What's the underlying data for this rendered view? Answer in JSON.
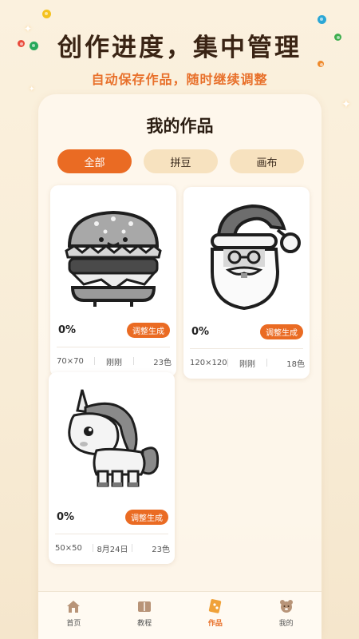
{
  "hero": {
    "title": "创作进度，集中管理",
    "subtitle": "自动保存作品，随时继续调整"
  },
  "panel": {
    "title": "我的作品",
    "tabs": [
      {
        "label": "全部",
        "active": true
      },
      {
        "label": "拼豆",
        "active": false
      },
      {
        "label": "画布",
        "active": false
      }
    ]
  },
  "works": [
    {
      "subject": "hamburger-pattern",
      "progress": "0%",
      "action": "调整生成",
      "size": "70×70",
      "time": "刚刚",
      "colors": "23色"
    },
    {
      "subject": "santa-pattern",
      "progress": "0%",
      "action": "调整生成",
      "size": "120×120",
      "time": "刚刚",
      "colors": "18色"
    },
    {
      "subject": "unicorn-pattern",
      "progress": "0%",
      "action": "调整生成",
      "size": "50×50",
      "time": "8月24日",
      "colors": "23色"
    }
  ],
  "nav": [
    {
      "label": "首页",
      "icon": "house-icon",
      "active": false
    },
    {
      "label": "教程",
      "icon": "book-icon",
      "active": false
    },
    {
      "label": "作品",
      "icon": "palette-icon",
      "active": true
    },
    {
      "label": "我的",
      "icon": "bear-face-icon",
      "active": false
    }
  ],
  "colors": {
    "accent": "#ea6b23",
    "tab_inactive": "#f7e2bf",
    "title": "#3a2414",
    "subtitle": "#e8702a"
  }
}
